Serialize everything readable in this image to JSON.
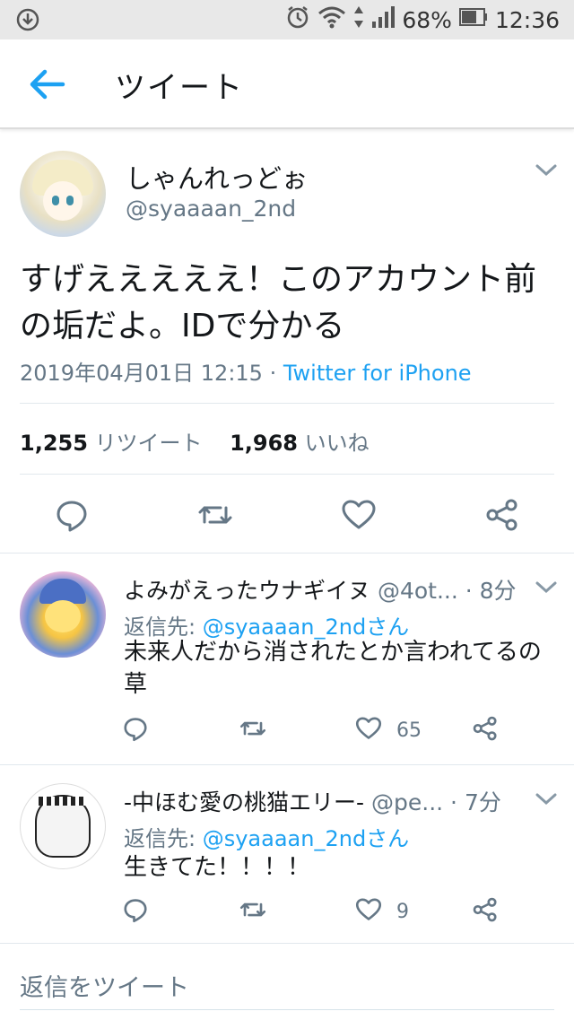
{
  "status_bar": {
    "battery": "68%",
    "time": "12:36",
    "icons": [
      "download-icon",
      "alarm-icon",
      "wifi-icon",
      "signal-icon",
      "battery-icon"
    ]
  },
  "app_bar": {
    "title": "ツイート",
    "back_icon": "arrow-left-icon"
  },
  "tweet": {
    "display_name": "しゃんれっどぉ",
    "handle": "@syaaaan_2nd",
    "text": "すげえええええ！このアカウント前の垢だよ。IDで分かる",
    "timestamp": "2019年04月01日 12:15",
    "separator": " · ",
    "source": "Twitter for iPhone",
    "retweet_count": "1,255",
    "retweet_label": "リツイート",
    "like_count": "1,968",
    "like_label": "いいね",
    "actions": [
      "reply-icon",
      "retweet-icon",
      "like-icon",
      "share-icon"
    ]
  },
  "replies": [
    {
      "display_name": "よみがえったウナギイヌ",
      "handle": "@4ot...",
      "time": "8分",
      "reply_prefix": "返信先: ",
      "reply_to": "@syaaaan_2ndさん",
      "text": "未来人だから消されたとか言われてるの草",
      "like_count": "65"
    },
    {
      "display_name": "-中ほむ愛の桃猫エリー-",
      "handle": "@pe...",
      "time": "7分",
      "reply_prefix": "返信先: ",
      "reply_to": "@syaaaan_2ndさん",
      "text": "生きてた！！！！",
      "like_count": "9"
    }
  ],
  "compose": {
    "placeholder": "返信をツイート"
  },
  "colors": {
    "accent": "#1da1f2",
    "text": "#14171a",
    "secondary": "#657786",
    "status_bar": "#e8e8e8"
  }
}
